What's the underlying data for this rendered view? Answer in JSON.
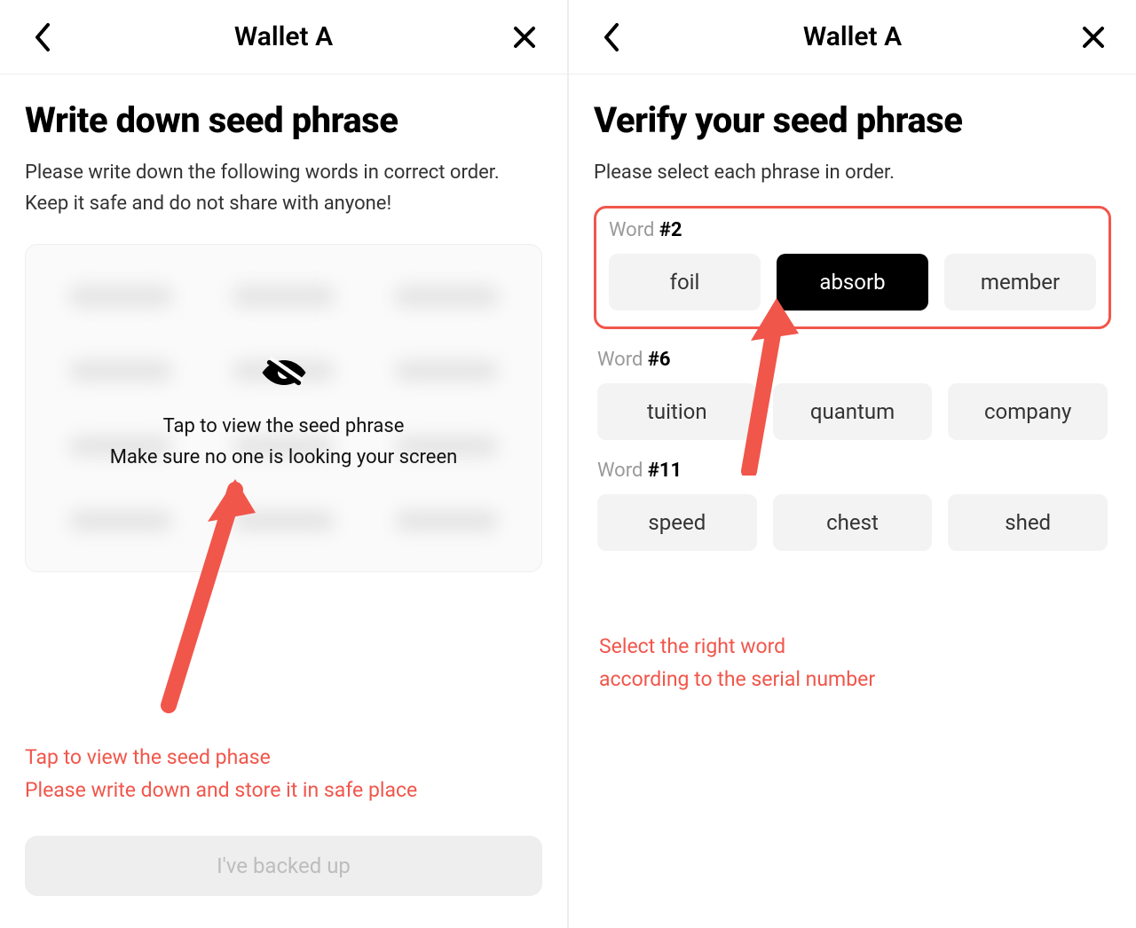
{
  "left": {
    "header": {
      "title": "Wallet A"
    },
    "heading": "Write down seed phrase",
    "subtext": "Please write down the following words in correct order. Keep it safe and do not share with anyone!",
    "seed_overlay": {
      "line1": "Tap to view the seed phrase",
      "line2": "Make sure no one is looking your screen"
    },
    "annotation": {
      "line1": "Tap to view the seed phase",
      "line2": "Please write down and store it in safe place"
    },
    "backup_button": "I've backed up"
  },
  "right": {
    "header": {
      "title": "Wallet A"
    },
    "heading": "Verify your seed phrase",
    "subtext": "Please select each phrase in order.",
    "groups": [
      {
        "label_prefix": "Word ",
        "label_num": "#2",
        "options": [
          "foil",
          "absorb",
          "member"
        ],
        "selected_index": 1,
        "highlighted": true
      },
      {
        "label_prefix": "Word ",
        "label_num": "#6",
        "options": [
          "tuition",
          "quantum",
          "company"
        ],
        "selected_index": -1,
        "highlighted": false
      },
      {
        "label_prefix": "Word ",
        "label_num": "#11",
        "options": [
          "speed",
          "chest",
          "shed"
        ],
        "selected_index": -1,
        "highlighted": false
      }
    ],
    "annotation": {
      "line1": "Select the right word",
      "line2": "according to the serial number"
    }
  },
  "colors": {
    "accent_red": "#f1564b"
  }
}
